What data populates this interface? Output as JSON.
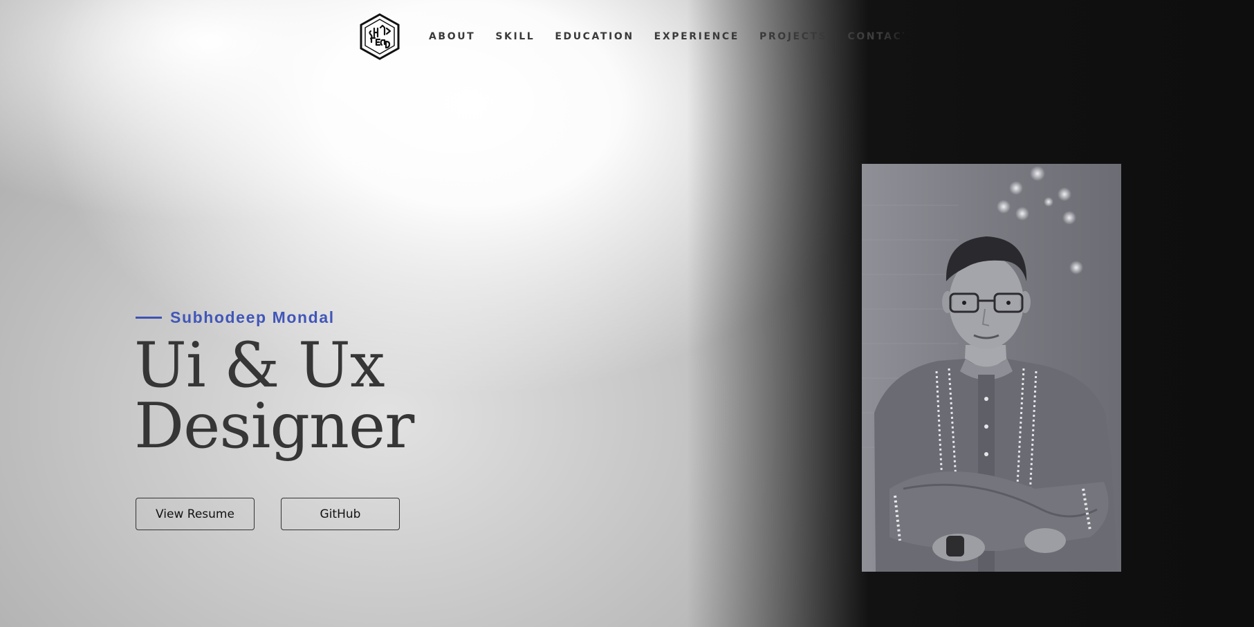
{
  "nav": {
    "logo_icon": "hexagon-monogram-logo-icon",
    "links": [
      {
        "label": "ABOUT"
      },
      {
        "label": "SKILL"
      },
      {
        "label": "EDUCATION"
      },
      {
        "label": "EXPERIENCE"
      },
      {
        "label": "PROJECTS"
      },
      {
        "label": "CONTACT"
      }
    ]
  },
  "hero": {
    "name": "Subhodeep Mondal",
    "title_line1": "Ui & Ux",
    "title_line2": "Designer",
    "buttons": {
      "resume_label": "View Resume",
      "github_label": "GitHub"
    }
  },
  "photo": {
    "icon": "portrait-photo"
  },
  "colors": {
    "accent": "#4156b8",
    "heading": "#363636",
    "nav_text": "#3a3a3a",
    "dark_bg": "#101010"
  }
}
